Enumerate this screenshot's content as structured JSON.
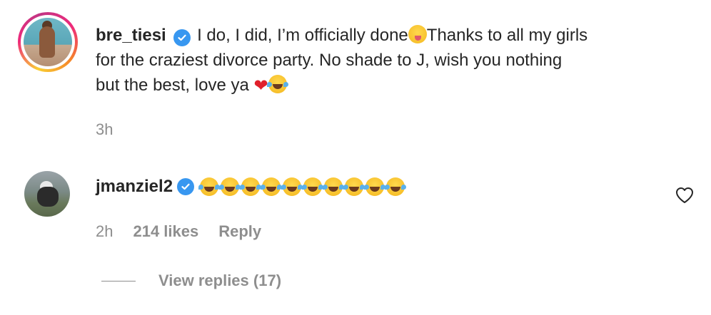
{
  "comments": [
    {
      "username": "bre_tiesi",
      "verified": true,
      "text_lines": [
        "I do, I did, I’m officially done",
        "Thanks to all my girls",
        "for the craziest divorce party. No shade to J, wish you nothing",
        "but the best, love ya"
      ],
      "emojis": [
        "zany-face",
        "red-heart",
        "face-with-tears-of-joy"
      ],
      "time": "3h"
    },
    {
      "username": "jmanziel2",
      "verified": true,
      "emojis_count": 10,
      "emoji": "face-with-tears-of-joy",
      "time": "2h",
      "likes": "214 likes",
      "reply_label": "Reply",
      "view_replies": "View replies (17)"
    }
  ],
  "icons": {
    "like": "heart-outline-icon",
    "verified": "verified-badge-icon"
  },
  "colors": {
    "verified": "#3897f0",
    "muted": "#8e8e8e",
    "text": "#262626",
    "heart": "#e0202b"
  }
}
